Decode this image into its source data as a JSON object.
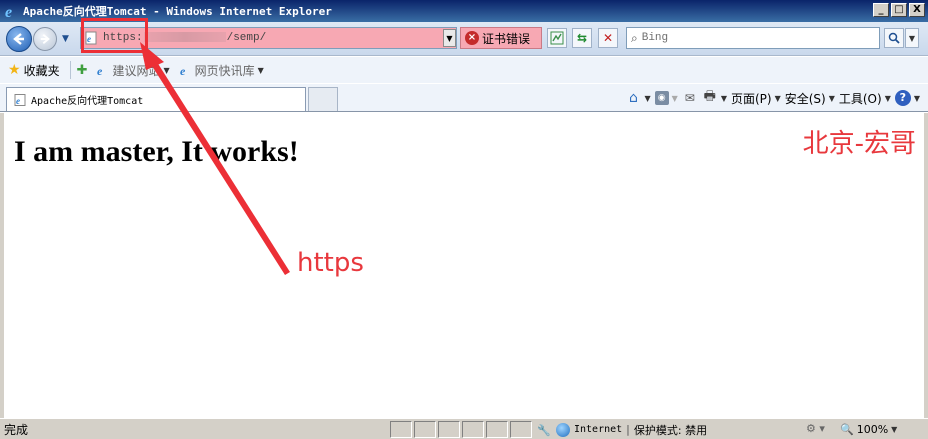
{
  "window": {
    "title": "Apache反向代理Tomcat - Windows Internet Explorer",
    "controls": [
      "_",
      "□",
      "X"
    ]
  },
  "nav": {
    "url_prefix": "https:",
    "url_suffix": "/semp/",
    "cert_error_label": "证书错误",
    "search_placeholder": "Bing"
  },
  "favorites": {
    "label": "收藏夹",
    "items": [
      "建议网站",
      "网页快讯库"
    ]
  },
  "tab": {
    "title": "Apache反向代理Tomcat"
  },
  "commands": {
    "page": "页面(P)",
    "safety": "安全(S)",
    "tools": "工具(O)"
  },
  "content": {
    "heading": "I am master, It works!",
    "watermark": "北京-宏哥",
    "annotation": "https"
  },
  "status": {
    "text": "完成",
    "zone": "Internet",
    "protected_mode": "保护模式: 禁用",
    "zoom": "100%"
  },
  "colors": {
    "annotation_red": "#e8383d",
    "address_error_pink": "#f7a8b3"
  }
}
